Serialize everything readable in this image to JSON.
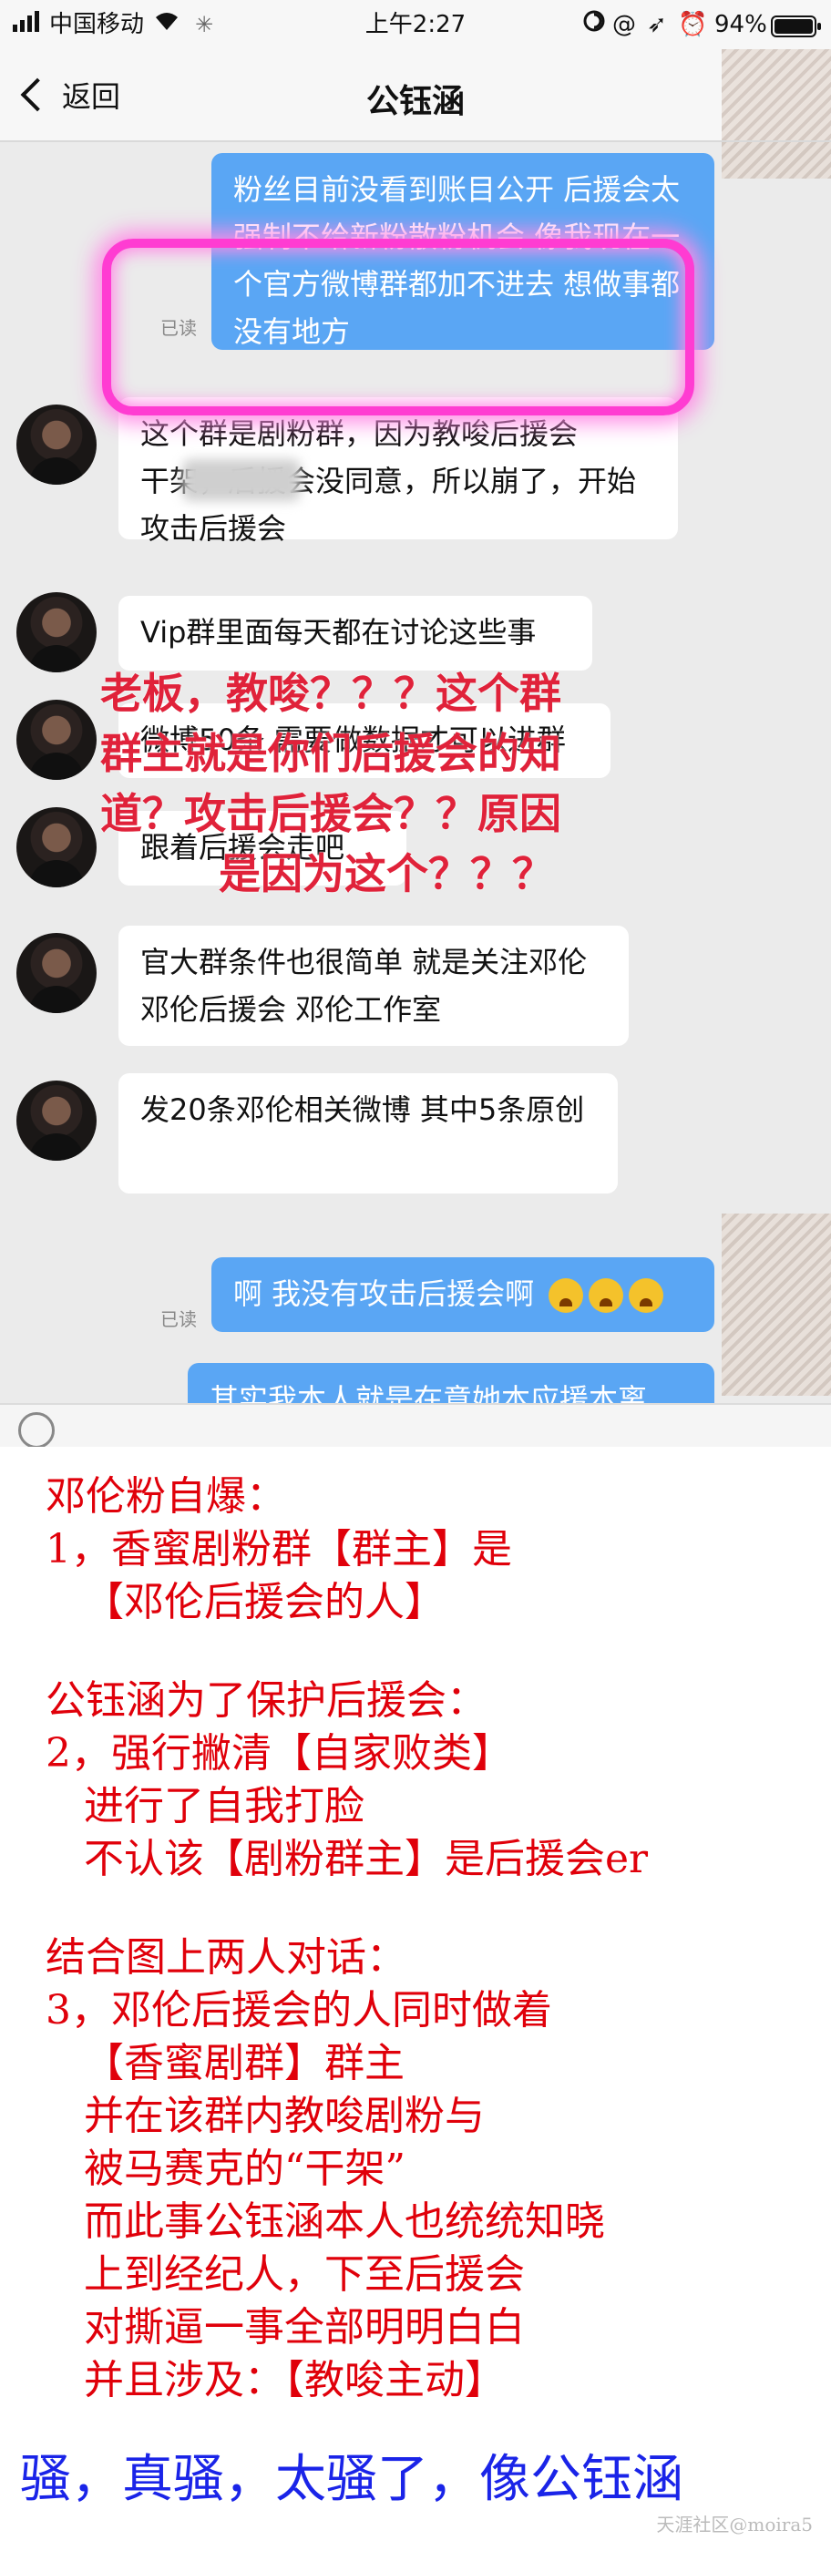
{
  "status_bar": {
    "carrier": "中国移动",
    "time": "上午2:27",
    "battery": "94%",
    "icons": [
      "signal-icon",
      "wifi-icon",
      "loading-icon",
      "lock-icon",
      "at-icon",
      "location-icon",
      "alarm-icon",
      "battery-icon"
    ]
  },
  "nav": {
    "back_label": "返回",
    "title": "公钰涵"
  },
  "messages": {
    "m1": "粉丝目前没看到账目公开 后援会太强制不给新粉散粉机会 像我现在一个官方微博群都加不进去 想做事都没有地方",
    "m1_read": "已读",
    "m2": "这个群是剧粉群，因为教唆后援会　　　　干架，后援会没同意，所以崩了，开始攻击后援会",
    "m3": "Vip群里面每天都在讨论这些事",
    "m4": "微博50条 需要做数据才可以进群",
    "m5": "跟着后援会走吧",
    "m6": "官大群条件也很简单 就是关注邓伦 邓伦后援会 邓伦工作室",
    "m7": "发20条邓伦相关微博 其中5条原创",
    "m8": "啊 我没有攻击后援会啊",
    "m8_read": "已读",
    "m9": "其实我本人就是在意她本应援本离"
  },
  "overlay_text": [
    "老板，教唆？？？这个群",
    "群主就是你们后援会的知",
    "道？攻击后援会？？原因",
    "是因为这个？？？"
  ],
  "notes": {
    "l1": "邓伦粉自爆：",
    "l2": "1，香蜜剧粉群【群主】是",
    "l3": "   【邓伦后援会的人】",
    "l4": "公钰涵为了保护后援会：",
    "l5": "2，强行撇清【自家败类】",
    "l6": "   进行了自我打脸",
    "l7": "   不认该【剧粉群主】是后援会er",
    "l8": "结合图上两人对话：",
    "l9": "3，邓伦后援会的人同时做着",
    "l10": "   【香蜜剧群】群主",
    "l11": "   并在该群内教唆剧粉与",
    "l12": "   被马赛克的“干架”",
    "l13": "   而此事公钰涵本人也统统知晓",
    "l14": "   上到经纪人，下至后援会",
    "l15": "   对撕逼一事全部明明白白",
    "l16": "   并且涉及：【教唆主动】",
    "footer": "骚，真骚，太骚了，像公钰涵"
  },
  "watermark": "天涯社区@moira5",
  "colors": {
    "accent_blue": "#5aa6f4",
    "highlight_pink": "#ff3cd2",
    "note_red": "#e0000a",
    "footer_blue": "#1a24e8"
  }
}
